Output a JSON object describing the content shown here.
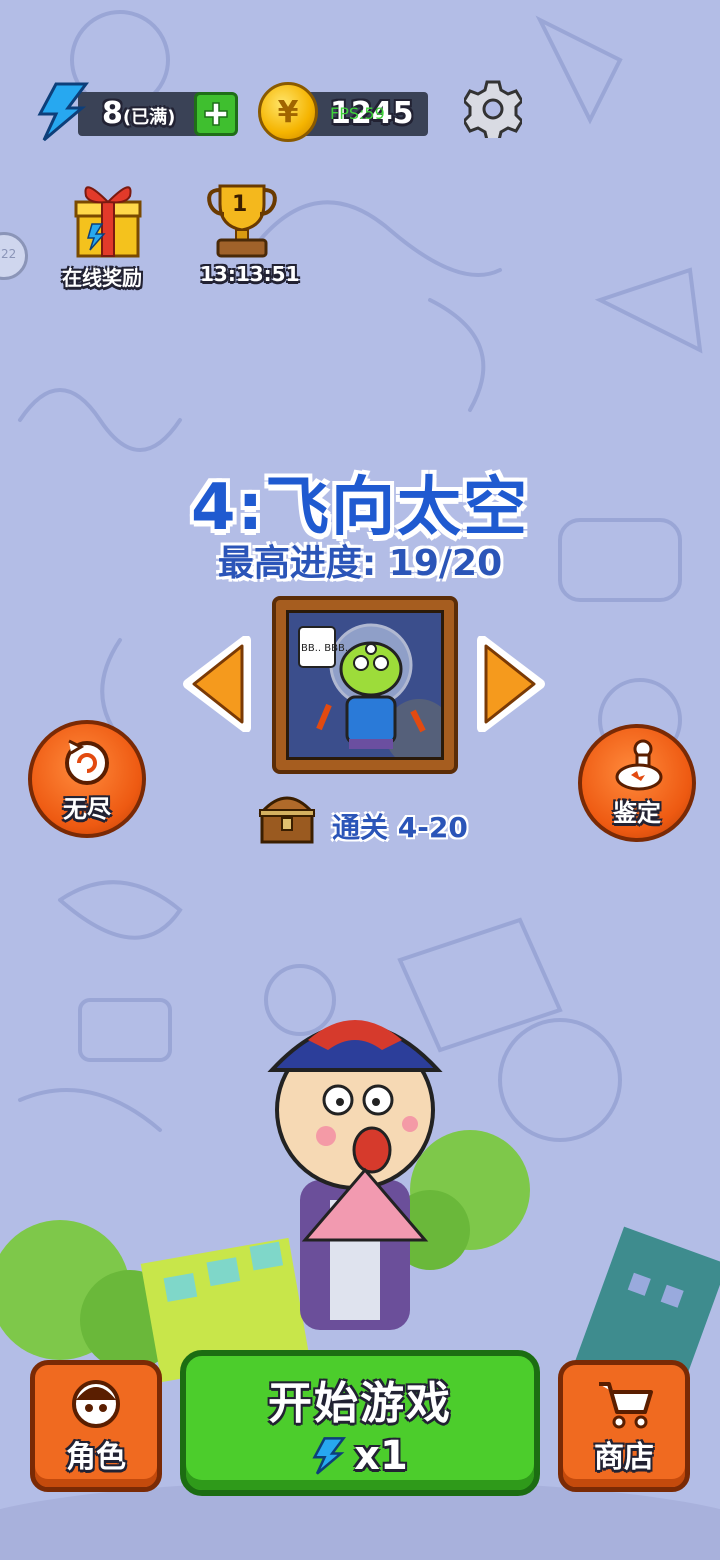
{
  "hud": {
    "energy_value": "8",
    "energy_status": "(已满)",
    "coins": "1245",
    "fps": "FPS:59"
  },
  "shortcuts": {
    "online_reward": "在线奖励",
    "leaderboard_rank": "1",
    "leaderboard_timer": "13:13:51",
    "side_tab": "22"
  },
  "level": {
    "title": "4:飞向太空",
    "best_progress": "最高进度: 19/20",
    "portrait_speech": "BB.. BBB..",
    "reward_text": "通关 4-20"
  },
  "side_buttons": {
    "endless": "无尽",
    "appraise": "鉴定"
  },
  "bottom": {
    "character": "角色",
    "start": "开始游戏",
    "start_cost": "x1",
    "shop": "商店"
  },
  "colors": {
    "background": "#b3bde6",
    "title_blue": "#1f5ad0",
    "start_green": "#4ccd2c",
    "button_orange": "#f06a20",
    "energy_blue": "#27a8f0"
  }
}
